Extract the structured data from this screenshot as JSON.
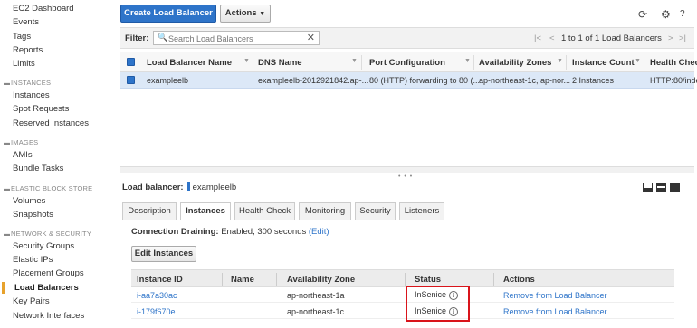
{
  "sidebar": {
    "top_items": [
      "EC2 Dashboard",
      "Events",
      "Tags",
      "Reports",
      "Limits"
    ],
    "sections": [
      {
        "title": "INSTANCES",
        "items": [
          "Instances",
          "Spot Requests",
          "Reserved Instances"
        ]
      },
      {
        "title": "IMAGES",
        "items": [
          "AMIs",
          "Bundle Tasks"
        ]
      },
      {
        "title": "ELASTIC BLOCK STORE",
        "items": [
          "Volumes",
          "Snapshots"
        ]
      },
      {
        "title": "NETWORK & SECURITY",
        "items": [
          "Security Groups",
          "Elastic IPs",
          "Placement Groups",
          "Load Balancers",
          "Key Pairs",
          "Network Interfaces"
        ]
      }
    ],
    "active_item": "Load Balancers"
  },
  "toolbar": {
    "create_label": "Create Load Balancer",
    "actions_label": "Actions",
    "icons": [
      "refresh-icon",
      "gear-icon",
      "help-icon"
    ]
  },
  "filter": {
    "label": "Filter:",
    "placeholder": "Search Load Balancers",
    "pagination": "1 to 1 of 1 Load Balancers"
  },
  "table": {
    "columns": [
      "Load Balancer Name",
      "DNS Name",
      "Port Configuration",
      "Availability Zones",
      "Instance Count",
      "Health Check"
    ],
    "rows": [
      {
        "name": "exampleelb",
        "dns": "exampleelb-2012921842.ap-...",
        "port": "80 (HTTP) forwarding to 80 (...",
        "zones": "ap-northeast-1c, ap-nor...",
        "count": "2 Instances",
        "health": "HTTP:80/inde"
      }
    ]
  },
  "details": {
    "title_label": "Load balancer:",
    "title_value": "exampleelb",
    "tabs": [
      "Description",
      "Instances",
      "Health Check",
      "Monitoring",
      "Security",
      "Listeners"
    ],
    "active_tab": "Instances",
    "draining_label": "Connection Draining:",
    "draining_value": "Enabled, 300 seconds",
    "draining_edit": "(Edit)",
    "edit_button": "Edit Instances",
    "instance_columns": [
      "Instance ID",
      "Name",
      "Availability Zone",
      "Status",
      "Actions"
    ],
    "instances": [
      {
        "id": "i-aa7a30ac",
        "name": "",
        "zone": "ap-northeast-1a",
        "status": "InSenice",
        "action": "Remove from Load Balancer"
      },
      {
        "id": "i-179f670e",
        "name": "",
        "zone": "ap-northeast-1c",
        "status": "InSenice",
        "action": "Remove from Load Balancer"
      }
    ]
  },
  "colors": {
    "primary": "#2e74c9",
    "active_marker": "#e7a22c",
    "highlight": "#d9141b",
    "selected_row": "#dce8f7"
  }
}
